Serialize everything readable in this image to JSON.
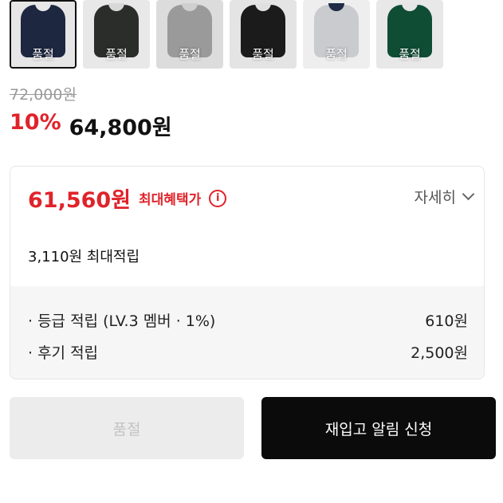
{
  "thumbnails": [
    {
      "label": "품절",
      "garment_color": "#1d2740",
      "collar_color": "#e8e8e8",
      "bg": "#e6e6e6",
      "selected": true
    },
    {
      "label": "품절",
      "garment_color": "#2b2d2a",
      "collar_color": "#d8d8d8",
      "bg": "#e8e8e8",
      "selected": false
    },
    {
      "label": "품절",
      "garment_color": "#9a9a9a",
      "collar_color": "#cfcfcf",
      "bg": "#dcdcdc",
      "selected": false
    },
    {
      "label": "품절",
      "garment_color": "#1b1b1b",
      "collar_color": "#e0e0e0",
      "bg": "#e4e4e4",
      "selected": false
    },
    {
      "label": "품절",
      "garment_color": "#c9cbcf",
      "collar_color": "#1f2b44",
      "bg": "#eeeeee",
      "selected": false
    },
    {
      "label": "품절",
      "garment_color": "#0f4d35",
      "collar_color": "#e6e6e6",
      "bg": "#e8e8e8",
      "selected": false
    }
  ],
  "price": {
    "original": "72,000원",
    "discount_rate": "10%",
    "sale": "64,800원"
  },
  "benefit": {
    "max_price": "61,560원",
    "max_label": "최대혜택가",
    "info_icon": "i",
    "detail_toggle": "자세히",
    "max_point": "3,110원 최대적립",
    "rows": [
      {
        "label": "· 등급 적립 (LV.3 멤버 · 1%)",
        "value": "610원"
      },
      {
        "label": "· 후기 적립",
        "value": "2,500원"
      }
    ]
  },
  "buttons": {
    "soldout": "품절",
    "restock": "재입고 알림 신청"
  },
  "colors": {
    "accent_red": "#e0232a",
    "primary_black": "#0b0b0b"
  }
}
